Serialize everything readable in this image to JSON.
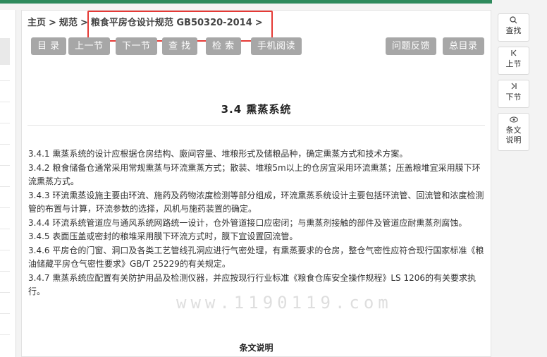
{
  "breadcrumb": {
    "home": "主页",
    "spec": "规范",
    "current": "粮食平房仓设计规范 GB50320-2014",
    "sep": ">"
  },
  "toolbar": {
    "toc": "目 录",
    "prev": "上一节",
    "next": "下一节",
    "search": "查 找",
    "retrieve": "检 索",
    "mobile": "手机阅读",
    "feedback": "问题反馈",
    "all_toc": "总目录"
  },
  "page": {
    "title": "3.4  熏蒸系统",
    "paragraphs": [
      "3.4.1 熏蒸系统的设计应根据仓房结构、廒间容量、堆粮形式及储粮品种，确定熏蒸方式和技术方案。",
      "3.4.2 粮食储备仓通常采用常规熏蒸与环流熏蒸方式；散装、堆粮5m以上的仓房宜采用环流熏蒸；压盖粮堆宜采用膜下环流熏蒸方式。",
      "3.4.3 环流熏蒸设施主要由环流、施药及药物浓度检测等部分组成，环流熏蒸系统设计主要包括环流管、回流管和浓度检测管的布置与计算，环流参数的选择，风机与施药装置的确定。",
      "3.4.4 环流系统管道应与通风系统网路统一设计，仓外管道接口应密闭；与熏蒸剂接触的部件及管道应耐熏蒸剂腐蚀。",
      "3.4.5 表面压盖或密封的粮堆采用膜下环流方式时，膜下宜设置回流管。",
      "3.4.6 平房仓的门窗、洞口及各类工艺管线孔洞应进行气密处理，有熏蒸要求的仓房，整仓气密性应符合现行国家标准《粮油储藏平房仓气密性要求》GB/T 25229的有关规定。",
      "3.4.7 熏蒸系统应配置有关防护用品及检测仪器，并应按现行行业标准《粮食仓库安全操作规程》LS 1206的有关要求执行。"
    ],
    "explain_heading": "条文说明",
    "watermark": "www.1190119.com"
  },
  "side": {
    "search": "查找",
    "prev": "上节",
    "next": "下节",
    "explain": "条文说明"
  },
  "colors": {
    "brand": "#2e8a5c",
    "button": "#a7a7a7",
    "highlight": "#e53935"
  }
}
